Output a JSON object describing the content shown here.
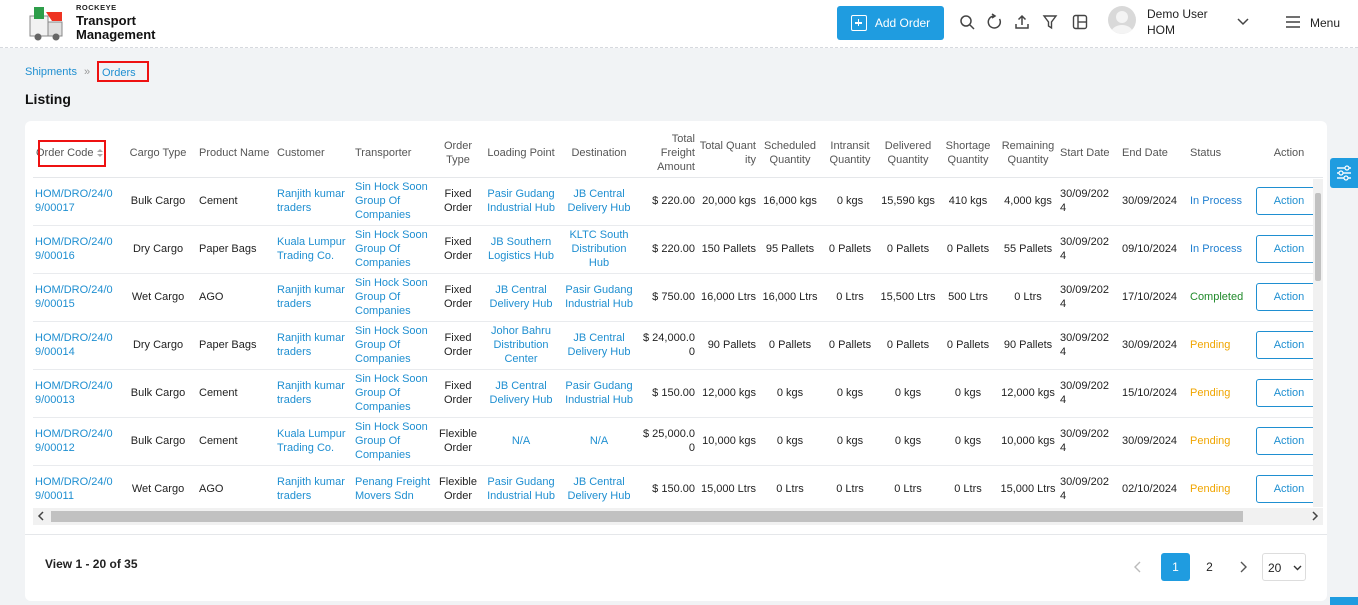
{
  "header": {
    "brand_small": "ROCKEYE",
    "brand_line1": "Transport",
    "brand_line2": "Management",
    "add_order_label": "Add Order",
    "user_name": "Demo User",
    "user_role": "HOM",
    "menu_label": "Menu",
    "icons": [
      "search-icon",
      "refresh-icon",
      "upload-icon",
      "filter-icon",
      "columns-icon"
    ]
  },
  "breadcrumb": {
    "parent": "Shipments",
    "separator": "»",
    "current": "Orders"
  },
  "page_title": "Listing",
  "table": {
    "headers": [
      "Order Code",
      "Cargo Type",
      "Product Name",
      "Customer",
      "Transporter",
      "Order Type",
      "Loading Point",
      "Destination",
      "Total Freight Amount",
      "Total Quantity",
      "Scheduled Quantity",
      "Intransit Quantity",
      "Delivered Quantity",
      "Shortage Quantity",
      "Remaining Quantity",
      "Start Date",
      "End Date",
      "Status",
      "Action"
    ],
    "rows": [
      {
        "code": "HOM/DRO/24/09/00017",
        "cargo": "Bulk Cargo",
        "product": "Cement",
        "customer": "Ranjith kumar traders",
        "transporter": "Sin Hock Soon Group Of Companies",
        "type": "Fixed Order",
        "loading": "Pasir Gudang Industrial Hub",
        "dest": "JB Central Delivery Hub",
        "freight": "$ 220.00",
        "qty": "20,000 kgs",
        "sched": "16,000 kgs",
        "intransit": "0 kgs",
        "delivered": "15,590 kgs",
        "shortage": "410 kgs",
        "remaining": "4,000 kgs",
        "start": "30/09/2024",
        "end": "30/09/2024",
        "status": "In Process",
        "action": "Action"
      },
      {
        "code": "HOM/DRO/24/09/00016",
        "cargo": "Dry Cargo",
        "product": "Paper Bags",
        "customer": "Kuala Lumpur Trading Co.",
        "transporter": "Sin Hock Soon Group Of Companies",
        "type": "Fixed Order",
        "loading": "JB Southern Logistics Hub",
        "dest": "KLTC South Distribution Hub",
        "freight": "$ 220.00",
        "qty": "150 Pallets",
        "sched": "95 Pallets",
        "intransit": "0 Pallets",
        "delivered": "0 Pallets",
        "shortage": "0 Pallets",
        "remaining": "55 Pallets",
        "start": "30/09/2024",
        "end": "09/10/2024",
        "status": "In Process",
        "action": "Action"
      },
      {
        "code": "HOM/DRO/24/09/00015",
        "cargo": "Wet Cargo",
        "product": "AGO",
        "customer": "Ranjith kumar traders",
        "transporter": "Sin Hock Soon Group Of Companies",
        "type": "Fixed Order",
        "loading": "JB Central Delivery Hub",
        "dest": "Pasir Gudang Industrial Hub",
        "freight": "$ 750.00",
        "qty": "16,000 Ltrs",
        "sched": "16,000 Ltrs",
        "intransit": "0 Ltrs",
        "delivered": "15,500 Ltrs",
        "shortage": "500 Ltrs",
        "remaining": "0 Ltrs",
        "start": "30/09/2024",
        "end": "17/10/2024",
        "status": "Completed",
        "action": "Action"
      },
      {
        "code": "HOM/DRO/24/09/00014",
        "cargo": "Dry Cargo",
        "product": "Paper Bags",
        "customer": "Ranjith kumar traders",
        "transporter": "Sin Hock Soon Group Of Companies",
        "type": "Fixed Order",
        "loading": "Johor Bahru Distribution Center",
        "dest": "JB Central Delivery Hub",
        "freight": "$ 24,000.00",
        "qty": "90 Pallets",
        "sched": "0 Pallets",
        "intransit": "0 Pallets",
        "delivered": "0 Pallets",
        "shortage": "0 Pallets",
        "remaining": "90 Pallets",
        "start": "30/09/2024",
        "end": "30/09/2024",
        "status": "Pending",
        "action": "Action"
      },
      {
        "code": "HOM/DRO/24/09/00013",
        "cargo": "Bulk Cargo",
        "product": "Cement",
        "customer": "Ranjith kumar traders",
        "transporter": "Sin Hock Soon Group Of Companies",
        "type": "Fixed Order",
        "loading": "JB Central Delivery Hub",
        "dest": "Pasir Gudang Industrial Hub",
        "freight": "$ 150.00",
        "qty": "12,000 kgs",
        "sched": "0 kgs",
        "intransit": "0 kgs",
        "delivered": "0 kgs",
        "shortage": "0 kgs",
        "remaining": "12,000 kgs",
        "start": "30/09/2024",
        "end": "15/10/2024",
        "status": "Pending",
        "action": "Action"
      },
      {
        "code": "HOM/DRO/24/09/00012",
        "cargo": "Bulk Cargo",
        "product": "Cement",
        "customer": "Kuala Lumpur Trading Co.",
        "transporter": "Sin Hock Soon Group Of Companies",
        "type": "Flexible Order",
        "loading": "N/A",
        "dest": "N/A",
        "freight": "$ 25,000.00",
        "qty": "10,000 kgs",
        "sched": "0 kgs",
        "intransit": "0 kgs",
        "delivered": "0 kgs",
        "shortage": "0 kgs",
        "remaining": "10,000 kgs",
        "start": "30/09/2024",
        "end": "30/09/2024",
        "status": "Pending",
        "action": "Action"
      },
      {
        "code": "HOM/DRO/24/09/00011",
        "cargo": "Wet Cargo",
        "product": "AGO",
        "customer": "Ranjith kumar traders",
        "transporter": "Penang Freight Movers Sdn",
        "type": "Flexible Order",
        "loading": "Pasir Gudang Industrial Hub",
        "dest": "JB Central Delivery Hub",
        "freight": "$ 150.00",
        "qty": "15,000 Ltrs",
        "sched": "0 Ltrs",
        "intransit": "0 Ltrs",
        "delivered": "0 Ltrs",
        "shortage": "0 Ltrs",
        "remaining": "15,000 Ltrs",
        "start": "30/09/2024",
        "end": "02/10/2024",
        "status": "Pending",
        "action": "Action"
      }
    ]
  },
  "footer": {
    "view_text": "View 1 - 20 of 35",
    "page1": "1",
    "page2": "2",
    "per_page": "20"
  },
  "colors": {
    "accent": "#1f9ce0",
    "link": "#1f8fd1",
    "highlight": "#e11111",
    "completed": "#1f8a2a",
    "pending": "#f0a500"
  }
}
